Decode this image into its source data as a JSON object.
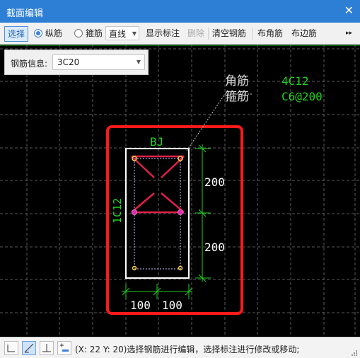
{
  "window": {
    "title": "截面编辑",
    "close_glyph": "✕"
  },
  "toolbar": {
    "select": "选择",
    "longitudinal": "纵筋",
    "stirrup": "箍筋",
    "line_mode": "直线",
    "show_dims": "显示标注",
    "delete": "删除",
    "clear_rebar": "清空钢筋",
    "corner_rebar": "布角筋",
    "edge_rebar": "布边筋",
    "more": "▸▸"
  },
  "info": {
    "label": "钢筋信息:",
    "value": "3C20"
  },
  "drawing": {
    "corner_label": "角筋",
    "corner_value": "4C12",
    "stirrup_label": "箍筋",
    "stirrup_value": "C6@200",
    "section_name": "BJ",
    "side_rebar": "1C12",
    "dim_upper": "200",
    "dim_lower": "200",
    "dim_left": "100",
    "dim_right": "100"
  },
  "status": {
    "text": "(X: 22 Y: 20)选择钢筋进行编辑，选择标注进行修改或移动;"
  },
  "colors": {
    "title_bg": "#2d7fd6",
    "dim_green": "#1fd41f",
    "rebar_red": "#e0204a",
    "highlight_red": "#ff1a1a",
    "label_white": "#dcdcdc"
  },
  "icons": [
    "close-icon",
    "dropdown-arrow-icon",
    "ortho-snap-icon",
    "angle-snap-icon",
    "perpendicular-snap-icon",
    "grid-snap-icon",
    "more-icon",
    "resize-grip-icon"
  ]
}
